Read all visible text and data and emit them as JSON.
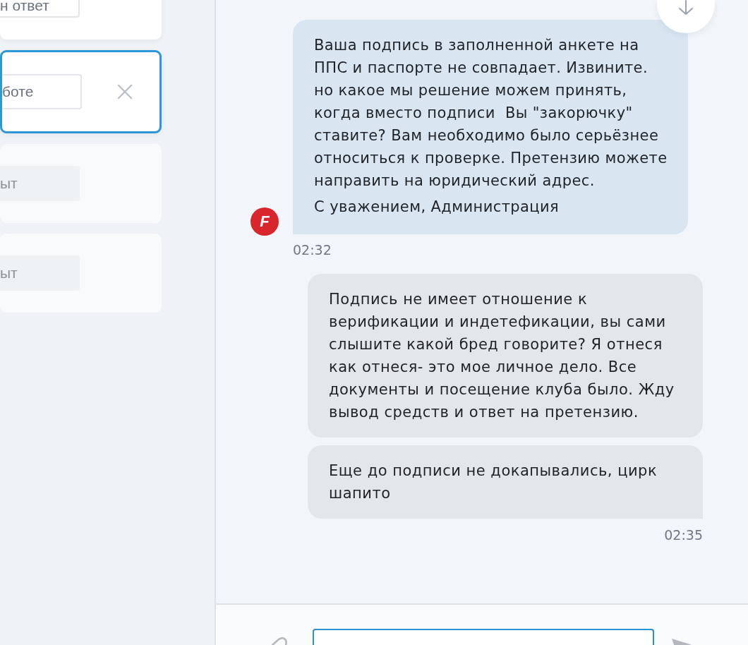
{
  "sidebar": {
    "tickets": [
      {
        "field_value": "н ответ",
        "selected": false,
        "disabled": false
      },
      {
        "field_value": "боте",
        "selected": true,
        "disabled": false
      },
      {
        "field_value": "ыт",
        "selected": false,
        "disabled": true
      },
      {
        "field_value": "ыт",
        "selected": false,
        "disabled": true
      }
    ]
  },
  "chat": {
    "messages": [
      {
        "kind": "incoming",
        "avatar": "F",
        "bubbles": [
          {
            "paragraphs": [
              "Ваша подпись в заполненной анкете на\nППС и паспорте не совпадает. Извините.\nно какое мы решение можем принять,\nкогда вместо подписи  Вы \"закорючку\"\nставите? Вам необходимо было серьёзнее\nотноситься к проверке. Претензию можете\nнаправить на юридический адрес.",
              "С уважением, Администрация"
            ]
          }
        ],
        "time": "02:32"
      },
      {
        "kind": "outgoing",
        "bubbles": [
          {
            "paragraphs": [
              "Подпись не имеет отношение к\nверификации и индетефикации, вы сами\nслышите какой бред говорите? Я отнеся\nкак отнеся- это мое личное дело. Все\nдокументы и посещение клуба было. Жду\nвывод средств и ответ на претензию."
            ]
          },
          {
            "paragraphs": [
              "Еще до подписи не докапывались, цирк\nшапито"
            ]
          }
        ],
        "time": "02:35"
      }
    ]
  }
}
